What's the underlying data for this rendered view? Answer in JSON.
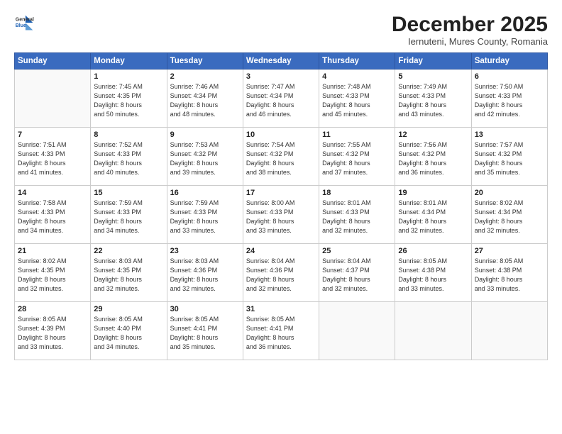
{
  "header": {
    "logo_general": "General",
    "logo_blue": "Blue",
    "month_title": "December 2025",
    "location": "Iernuteni, Mures County, Romania"
  },
  "weekdays": [
    "Sunday",
    "Monday",
    "Tuesday",
    "Wednesday",
    "Thursday",
    "Friday",
    "Saturday"
  ],
  "weeks": [
    [
      {
        "num": "",
        "detail": ""
      },
      {
        "num": "1",
        "detail": "Sunrise: 7:45 AM\nSunset: 4:35 PM\nDaylight: 8 hours\nand 50 minutes."
      },
      {
        "num": "2",
        "detail": "Sunrise: 7:46 AM\nSunset: 4:34 PM\nDaylight: 8 hours\nand 48 minutes."
      },
      {
        "num": "3",
        "detail": "Sunrise: 7:47 AM\nSunset: 4:34 PM\nDaylight: 8 hours\nand 46 minutes."
      },
      {
        "num": "4",
        "detail": "Sunrise: 7:48 AM\nSunset: 4:33 PM\nDaylight: 8 hours\nand 45 minutes."
      },
      {
        "num": "5",
        "detail": "Sunrise: 7:49 AM\nSunset: 4:33 PM\nDaylight: 8 hours\nand 43 minutes."
      },
      {
        "num": "6",
        "detail": "Sunrise: 7:50 AM\nSunset: 4:33 PM\nDaylight: 8 hours\nand 42 minutes."
      }
    ],
    [
      {
        "num": "7",
        "detail": "Sunrise: 7:51 AM\nSunset: 4:33 PM\nDaylight: 8 hours\nand 41 minutes."
      },
      {
        "num": "8",
        "detail": "Sunrise: 7:52 AM\nSunset: 4:33 PM\nDaylight: 8 hours\nand 40 minutes."
      },
      {
        "num": "9",
        "detail": "Sunrise: 7:53 AM\nSunset: 4:32 PM\nDaylight: 8 hours\nand 39 minutes."
      },
      {
        "num": "10",
        "detail": "Sunrise: 7:54 AM\nSunset: 4:32 PM\nDaylight: 8 hours\nand 38 minutes."
      },
      {
        "num": "11",
        "detail": "Sunrise: 7:55 AM\nSunset: 4:32 PM\nDaylight: 8 hours\nand 37 minutes."
      },
      {
        "num": "12",
        "detail": "Sunrise: 7:56 AM\nSunset: 4:32 PM\nDaylight: 8 hours\nand 36 minutes."
      },
      {
        "num": "13",
        "detail": "Sunrise: 7:57 AM\nSunset: 4:32 PM\nDaylight: 8 hours\nand 35 minutes."
      }
    ],
    [
      {
        "num": "14",
        "detail": "Sunrise: 7:58 AM\nSunset: 4:33 PM\nDaylight: 8 hours\nand 34 minutes."
      },
      {
        "num": "15",
        "detail": "Sunrise: 7:59 AM\nSunset: 4:33 PM\nDaylight: 8 hours\nand 34 minutes."
      },
      {
        "num": "16",
        "detail": "Sunrise: 7:59 AM\nSunset: 4:33 PM\nDaylight: 8 hours\nand 33 minutes."
      },
      {
        "num": "17",
        "detail": "Sunrise: 8:00 AM\nSunset: 4:33 PM\nDaylight: 8 hours\nand 33 minutes."
      },
      {
        "num": "18",
        "detail": "Sunrise: 8:01 AM\nSunset: 4:33 PM\nDaylight: 8 hours\nand 32 minutes."
      },
      {
        "num": "19",
        "detail": "Sunrise: 8:01 AM\nSunset: 4:34 PM\nDaylight: 8 hours\nand 32 minutes."
      },
      {
        "num": "20",
        "detail": "Sunrise: 8:02 AM\nSunset: 4:34 PM\nDaylight: 8 hours\nand 32 minutes."
      }
    ],
    [
      {
        "num": "21",
        "detail": "Sunrise: 8:02 AM\nSunset: 4:35 PM\nDaylight: 8 hours\nand 32 minutes."
      },
      {
        "num": "22",
        "detail": "Sunrise: 8:03 AM\nSunset: 4:35 PM\nDaylight: 8 hours\nand 32 minutes."
      },
      {
        "num": "23",
        "detail": "Sunrise: 8:03 AM\nSunset: 4:36 PM\nDaylight: 8 hours\nand 32 minutes."
      },
      {
        "num": "24",
        "detail": "Sunrise: 8:04 AM\nSunset: 4:36 PM\nDaylight: 8 hours\nand 32 minutes."
      },
      {
        "num": "25",
        "detail": "Sunrise: 8:04 AM\nSunset: 4:37 PM\nDaylight: 8 hours\nand 32 minutes."
      },
      {
        "num": "26",
        "detail": "Sunrise: 8:05 AM\nSunset: 4:38 PM\nDaylight: 8 hours\nand 33 minutes."
      },
      {
        "num": "27",
        "detail": "Sunrise: 8:05 AM\nSunset: 4:38 PM\nDaylight: 8 hours\nand 33 minutes."
      }
    ],
    [
      {
        "num": "28",
        "detail": "Sunrise: 8:05 AM\nSunset: 4:39 PM\nDaylight: 8 hours\nand 33 minutes."
      },
      {
        "num": "29",
        "detail": "Sunrise: 8:05 AM\nSunset: 4:40 PM\nDaylight: 8 hours\nand 34 minutes."
      },
      {
        "num": "30",
        "detail": "Sunrise: 8:05 AM\nSunset: 4:41 PM\nDaylight: 8 hours\nand 35 minutes."
      },
      {
        "num": "31",
        "detail": "Sunrise: 8:05 AM\nSunset: 4:41 PM\nDaylight: 8 hours\nand 36 minutes."
      },
      {
        "num": "",
        "detail": ""
      },
      {
        "num": "",
        "detail": ""
      },
      {
        "num": "",
        "detail": ""
      }
    ]
  ]
}
